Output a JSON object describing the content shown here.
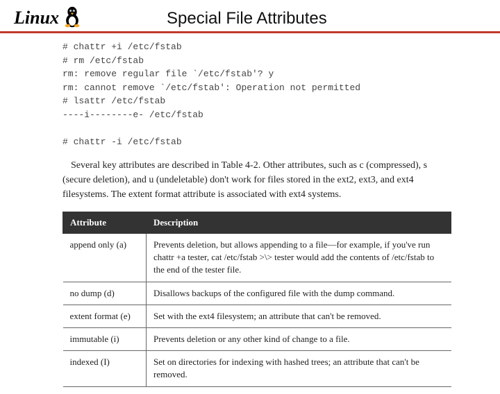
{
  "header": {
    "logo_text": "Linux",
    "title": "Special File Attributes"
  },
  "terminal": "# chattr +i /etc/fstab\n# rm /etc/fstab\nrm: remove regular file `/etc/fstab'? y\nrm: cannot remove `/etc/fstab': Operation not permitted\n# lsattr /etc/fstab\n----i--------e- /etc/fstab\n\n# chattr -i /etc/fstab",
  "paragraph": "Several key attributes are described in Table 4-2. Other attributes, such as c (compressed), s (secure deletion), and u (undeletable) don't work for files stored in the ext2, ext3, and ext4 filesystems. The extent format attribute is associated with ext4 systems.",
  "table": {
    "headers": {
      "attr": "Attribute",
      "desc": "Description"
    },
    "rows": [
      {
        "attr": "append only (a)",
        "desc": "Prevents deletion, but allows appending to a file—for example, if you've run chattr +a tester, cat /etc/fstab >\\> tester would add the contents of /etc/fstab to the end of the tester file."
      },
      {
        "attr": "no dump (d)",
        "desc": "Disallows backups of the configured file with the dump command."
      },
      {
        "attr": "extent format (e)",
        "desc": "Set with the ext4 filesystem; an attribute that can't be removed."
      },
      {
        "attr": "immutable (i)",
        "desc": "Prevents deletion or any other kind of change to a file."
      },
      {
        "attr": "indexed (I)",
        "desc": "Set on directories for indexing with hashed trees; an attribute that can't be removed."
      }
    ]
  }
}
